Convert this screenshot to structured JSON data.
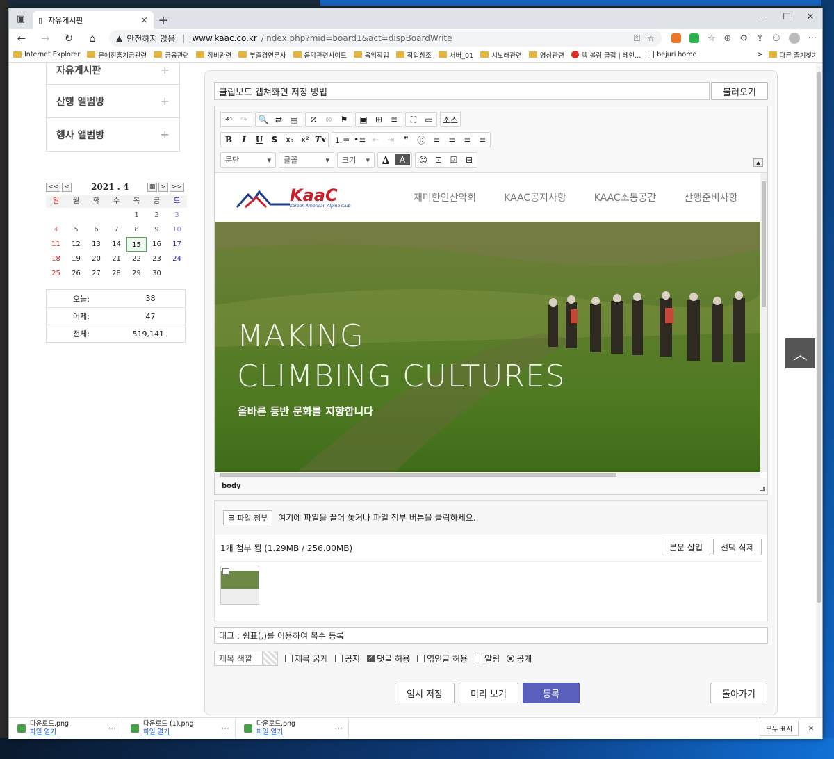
{
  "browser": {
    "tab_title": "자유게시판",
    "tab_close": "×",
    "new_tab": "+",
    "win_min": "–",
    "win_max": "☐",
    "win_close": "✕",
    "back": "←",
    "forward": "→",
    "reload": "↻",
    "home": "⌂",
    "warning": "▲",
    "insecure": "안전하지 않음",
    "sep": "|",
    "url_host": "www.kaac.co.kr",
    "url_path": "/index.php?mid=board1&act=dispBoardWrite",
    "more": "···"
  },
  "bookmarks": {
    "items": [
      "Internet Explorer",
      "문예진흥기금관련",
      "금융관련",
      "장비관련",
      "부출경연론사",
      "음악관련사이트",
      "음악작업",
      "작업참조",
      "서버_01",
      "시노래관련",
      "영상관련",
      "맥 볼링 클럽 | 레인...",
      "bejuri home"
    ],
    "other": "다른 즐겨찾기",
    "chevron": ">"
  },
  "sidebar": {
    "menu": [
      {
        "label": "자유게시판",
        "icon": "+"
      },
      {
        "label": "산행 앨범방",
        "icon": "+"
      },
      {
        "label": "행사 앨범방",
        "icon": "+"
      }
    ]
  },
  "calendar": {
    "prev_year": "<<",
    "prev_month": "<",
    "title": "2021 . 4",
    "cal_icon": "▦",
    "next_month": ">",
    "next_year": ">>",
    "weekdays": [
      "일",
      "월",
      "화",
      "수",
      "목",
      "금",
      "토"
    ],
    "weeks": [
      [
        "",
        "",
        "",
        "",
        "1",
        "2",
        "3"
      ],
      [
        "4",
        "5",
        "6",
        "7",
        "8",
        "9",
        "10"
      ],
      [
        "11",
        "12",
        "13",
        "14",
        "15",
        "16",
        "17"
      ],
      [
        "18",
        "19",
        "20",
        "21",
        "22",
        "23",
        "24"
      ],
      [
        "25",
        "26",
        "27",
        "28",
        "29",
        "30",
        ""
      ]
    ],
    "today": "15"
  },
  "stats": [
    {
      "label": "오늘:",
      "value": "38"
    },
    {
      "label": "어제:",
      "value": "47"
    },
    {
      "label": "전체:",
      "value": "519,141"
    }
  ],
  "form": {
    "title_value": "클립보드 캡쳐화면 저장 방법",
    "load_button": "불러오기"
  },
  "toolbar": {
    "row1": [
      "↶",
      "↷",
      "🔍",
      "⇄",
      "▤",
      "⊘",
      "⊗",
      "⚑",
      "▣",
      "⊞",
      "≡",
      "⛶",
      "▭",
      "소스"
    ],
    "row2": [
      "B",
      "I",
      "U",
      "S",
      "x₂",
      "x²",
      "Tx",
      "⒈≡",
      "•≡",
      "⇤",
      "⇥",
      "❞",
      "Ⓓ",
      "≡",
      "≡",
      "≡",
      "≡"
    ],
    "paragraph": "문단",
    "font": "글꼴",
    "size": "크기",
    "font_color": "A",
    "bg_color": "A",
    "row3_icons": [
      "☺",
      "⊡",
      "☑",
      "⊟"
    ],
    "collapse": "▲"
  },
  "content": {
    "logo": "KaaC",
    "logo_sub": "Korean American Alpine Club",
    "nav": [
      "재미한인산악회",
      "KAAC공지사항",
      "KAAC소통공간",
      "산행준비사항"
    ],
    "hero_line1": "MAKING",
    "hero_line2": "CLIMBING CULTURES",
    "hero_sub": "올바른 등반 문화를 지향합니다",
    "status_path": "body"
  },
  "attachments": {
    "file_button": "파일 첨부",
    "hint": "여기에 파일을 끌어 놓거나 파일 첨부 버튼을 클릭하세요.",
    "summary": "1개 첨부 됨 (1.29MB / 256.00MB)",
    "insert_button": "본문 삽입",
    "delete_button": "선택 삭제"
  },
  "tags": {
    "value": "태그 : 쉼표(,)를 이용하여 복수 등록"
  },
  "options": {
    "title_color": "제목 색깔",
    "bold_title": {
      "label": "제목 굵게",
      "checked": false
    },
    "notice": {
      "label": "공지",
      "checked": false
    },
    "allow_comment": {
      "label": "댓글 허용",
      "checked": true
    },
    "allow_trackback": {
      "label": "엮인글 허용",
      "checked": false
    },
    "notify": {
      "label": "알림",
      "checked": false
    },
    "public": {
      "label": "공개",
      "selected": true
    }
  },
  "actions": {
    "temp_save": "임시 저장",
    "preview": "미리 보기",
    "submit": "등록",
    "back": "돌아가기"
  },
  "scroll_top": "︿",
  "downloads": {
    "items": [
      {
        "name": "다운로드.png",
        "action": "파일 열기"
      },
      {
        "name": "다운로드 (1).png",
        "action": "파일 열기"
      },
      {
        "name": "다운로드.png",
        "action": "파일 열기"
      }
    ],
    "more": "···",
    "show_all": "모두 표시",
    "close": "✕"
  },
  "colors": {
    "primary_button": "#5a5fbe",
    "logo_red": "#c8202a",
    "today_border": "#5a5"
  }
}
